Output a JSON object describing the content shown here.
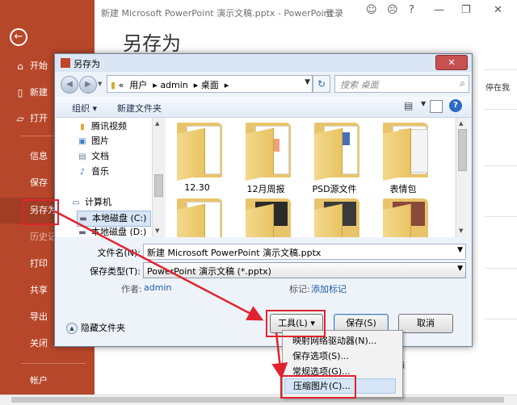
{
  "app": {
    "window_title": "新建 Microsoft PowerPoint 演示文稿.pptx - PowerPoint",
    "login": "登录",
    "page_title": "另存为"
  },
  "sidebar": {
    "items": [
      {
        "label": "开始",
        "icon": "home-icon"
      },
      {
        "label": "新建",
        "icon": "new-document-icon"
      },
      {
        "label": "打开",
        "icon": "open-folder-icon"
      },
      {
        "label": "信息"
      },
      {
        "label": "保存"
      },
      {
        "label": "另存为"
      },
      {
        "label": "历史记"
      },
      {
        "label": "打印"
      },
      {
        "label": "共享"
      },
      {
        "label": "导出"
      },
      {
        "label": "关闭"
      },
      {
        "label": "帐户"
      }
    ]
  },
  "background_text": {
    "right_top": "停在我",
    "right_line2": "",
    "right_bottom": "档"
  },
  "dialog": {
    "title": "另存为",
    "breadcrumb": [
      "«",
      "用户",
      "admin",
      "桌面"
    ],
    "search_placeholder": "搜索 桌面",
    "toolbar": {
      "organize": "组织",
      "new_folder": "新建文件夹"
    },
    "nav_items": [
      {
        "label": "腾讯视频",
        "icon": "folder-icon"
      },
      {
        "label": "图片",
        "icon": "pictures-icon"
      },
      {
        "label": "文档",
        "icon": "documents-icon"
      },
      {
        "label": "音乐",
        "icon": "music-icon"
      },
      {
        "label": "计算机",
        "icon": "computer-icon"
      },
      {
        "label": "本地磁盘 (C:)",
        "icon": "drive-icon"
      },
      {
        "label": "本地磁盘 (D:)",
        "icon": "drive-icon"
      }
    ],
    "files": [
      {
        "label": "12.30"
      },
      {
        "label": "12月周报"
      },
      {
        "label": "PSD源文件"
      },
      {
        "label": "表情包"
      },
      {
        "label": ""
      },
      {
        "label": ""
      },
      {
        "label": ""
      },
      {
        "label": ""
      }
    ],
    "filename_label": "文件名(N):",
    "filename_value": "新建 Microsoft PowerPoint 演示文稿.pptx",
    "filetype_label": "保存类型(T):",
    "filetype_value": "PowerPoint 演示文稿 (*.pptx)",
    "author_label": "作者:",
    "author_value": "admin",
    "tags_label": "标记:",
    "tags_value": "添加标记",
    "hide_folders": "隐藏文件夹",
    "tools_button": "工具(L)",
    "save_button": "保存(S)",
    "cancel_button": "取消"
  },
  "tools_menu": {
    "items": [
      "映射网络驱动器(N)...",
      "保存选项(S)...",
      "常规选项(G)...",
      "压缩图片(C)..."
    ]
  },
  "colors": {
    "sidebar": "#b7472a",
    "highlight_box": "#e0232e",
    "link": "#1e5aa8"
  }
}
